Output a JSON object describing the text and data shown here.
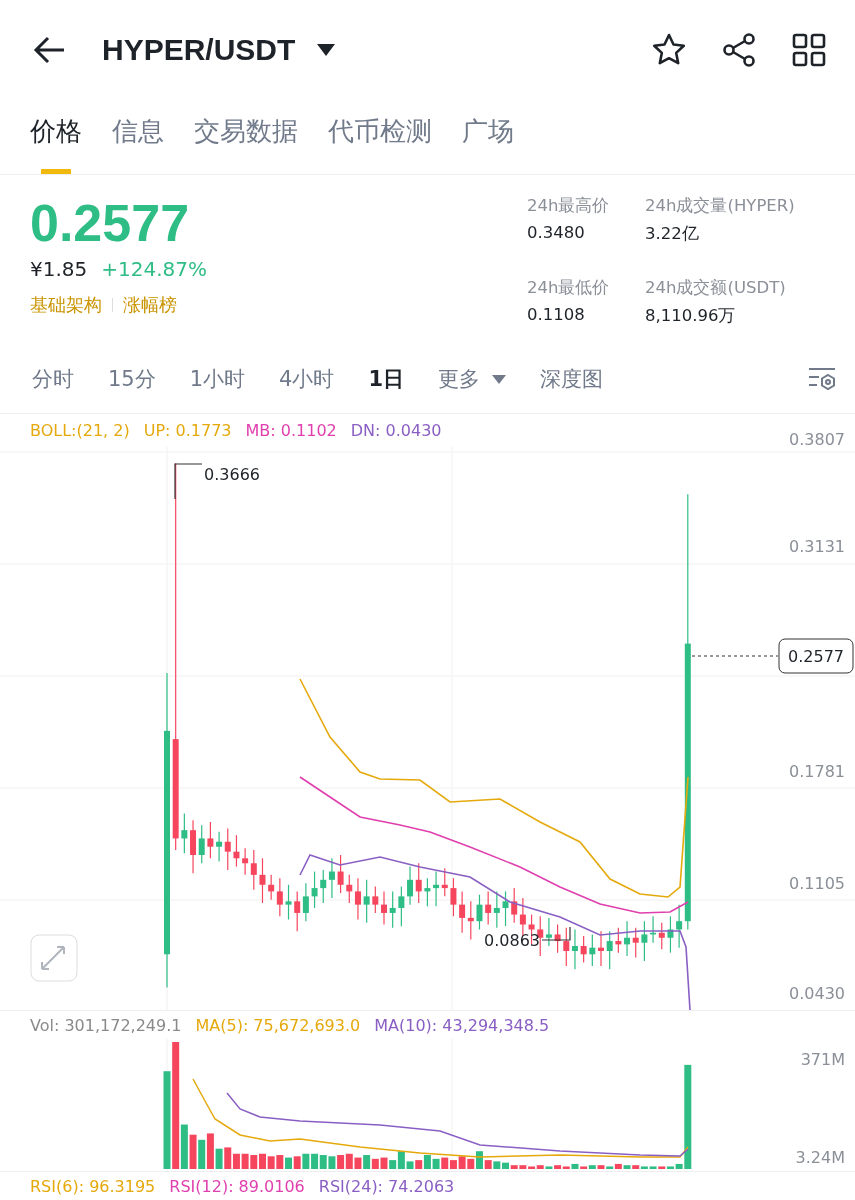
{
  "header": {
    "title": "HYPER/USDT"
  },
  "tabs": [
    {
      "label": "价格",
      "selected": true
    },
    {
      "label": "信息",
      "selected": false
    },
    {
      "label": "交易数据",
      "selected": false
    },
    {
      "label": "代币检测",
      "selected": false
    },
    {
      "label": "广场",
      "selected": false
    }
  ],
  "ticker": {
    "price": "0.2577",
    "fiat_price": "¥1.85",
    "change": "+124.87%",
    "tags": [
      "基础架构",
      "涨幅榜"
    ],
    "stats": [
      {
        "label": "24h最高价",
        "value": "0.3480"
      },
      {
        "label": "24h成交量(HYPER)",
        "value": "3.22亿"
      },
      {
        "label": "24h最低价",
        "value": "0.1108"
      },
      {
        "label": "24h成交额(USDT)",
        "value": "8,110.96万"
      }
    ]
  },
  "intervals": [
    {
      "label": "分时",
      "kind": "plain",
      "selected": false
    },
    {
      "label": "15分",
      "kind": "plain",
      "selected": false
    },
    {
      "label": "1小时",
      "kind": "plain",
      "selected": false
    },
    {
      "label": "4小时",
      "kind": "plain",
      "selected": false
    },
    {
      "label": "1日",
      "kind": "plain",
      "selected": true
    },
    {
      "label": "更多",
      "kind": "dropdown",
      "selected": false
    },
    {
      "label": "深度图",
      "kind": "plain",
      "selected": false
    }
  ],
  "price_chart": {
    "legend": [
      {
        "text": "BOLL:(21, 2)",
        "color": "#e5a90c"
      },
      {
        "text": "UP: 0.1773",
        "color": "#e5a90c"
      },
      {
        "text": "MB: 0.1102",
        "color": "#e03fae"
      },
      {
        "text": "DN: 0.0430",
        "color": "#8a5fc4"
      }
    ],
    "axis_labels": [
      "0.3807",
      "0.3131",
      "0.1781",
      "0.1105",
      "0.0430"
    ],
    "high_label": "0.3666",
    "low_label": "0.0863",
    "last_price": "0.2577"
  },
  "volume_chart": {
    "legend": [
      {
        "text": "Vol: 301,172,249.1",
        "color": "#8a8a8a"
      },
      {
        "text": "MA(5): 75,672,693.0",
        "color": "#e5a90c"
      },
      {
        "text": "MA(10): 43,294,348.5",
        "color": "#8a5fc4"
      }
    ],
    "axis_labels": [
      "371M",
      "3.24M"
    ]
  },
  "rsi": {
    "legend": [
      {
        "text": "RSI(6): 96.3195",
        "color": "#e5a90c"
      },
      {
        "text": "RSI(12): 89.0106",
        "color": "#e03fae"
      },
      {
        "text": "RSI(24): 74.2063",
        "color": "#8a5fc4"
      }
    ]
  }
}
